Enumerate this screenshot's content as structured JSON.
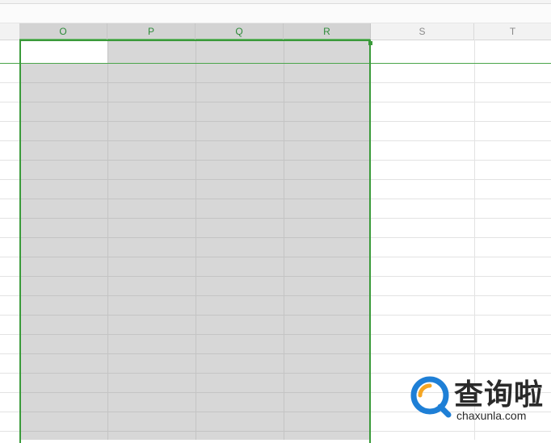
{
  "columns": [
    {
      "label": "O",
      "selected": true
    },
    {
      "label": "P",
      "selected": true
    },
    {
      "label": "Q",
      "selected": true
    },
    {
      "label": "R",
      "selected": true
    },
    {
      "label": "S",
      "selected": false
    },
    {
      "label": "T",
      "selected": false
    }
  ],
  "watermark": {
    "name": "查询啦",
    "domain": "chaxunla.com"
  },
  "colors": {
    "selection_border": "#3a9a3a",
    "selected_header_text": "#2e8b3a",
    "selection_fill": "#d7d7d7",
    "logo_blue": "#1e7fd6",
    "logo_orange": "#f5a623"
  }
}
